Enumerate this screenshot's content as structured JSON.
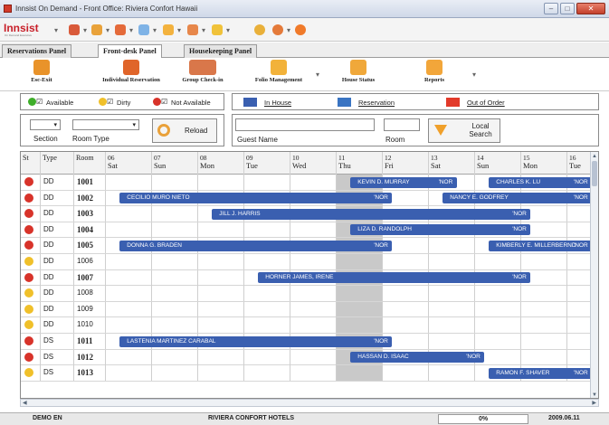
{
  "window": {
    "title": "Innsist On Demand - Front Office: Riviera Confort Hawaii"
  },
  "toolbar": {
    "logo": "Innsist",
    "logo_sub": "On Demand Executive"
  },
  "tabs": [
    "Reservations Panel",
    "Front-desk Panel",
    "Housekeeping Panel"
  ],
  "active_tab": 1,
  "actions": [
    {
      "label": "Esc-Exit",
      "icon": "exit-icon"
    },
    {
      "label": "Individual Reservation",
      "icon": "person-icon"
    },
    {
      "label": "Group Check-in",
      "icon": "group-icon"
    },
    {
      "label": "Folio Management",
      "icon": "folio-icon"
    },
    {
      "label": "House Status",
      "icon": "house-status-icon"
    },
    {
      "label": "Reports",
      "icon": "reports-icon"
    }
  ],
  "legend_status": {
    "available": "Available",
    "dirty": "Dirty",
    "not_available": "Not Available"
  },
  "legend_types": {
    "in_house": "In House",
    "reservation": "Reservation",
    "out_of_order": "Out of Order"
  },
  "filters": {
    "section_label": "Section",
    "room_type_label": "Room Type",
    "reload": "Reload",
    "guest_name_label": "Guest Name",
    "room_label": "Room",
    "local_search": "Local Search"
  },
  "grid": {
    "col_headers": {
      "st": "St",
      "type": "Type",
      "room": "Room"
    },
    "days": [
      {
        "num": "06",
        "day": "Sat"
      },
      {
        "num": "07",
        "day": "Sun"
      },
      {
        "num": "08",
        "day": "Mon"
      },
      {
        "num": "09",
        "day": "Tue"
      },
      {
        "num": "10",
        "day": "Wed"
      },
      {
        "num": "11",
        "day": "Thu"
      },
      {
        "num": "12",
        "day": "Fri"
      },
      {
        "num": "13",
        "day": "Sat"
      },
      {
        "num": "14",
        "day": "Sun"
      },
      {
        "num": "15",
        "day": "Mon"
      },
      {
        "num": "16",
        "day": "Tue"
      }
    ],
    "rows": [
      {
        "status": "red",
        "type": "DD",
        "room": "1001",
        "bold": true
      },
      {
        "status": "red",
        "type": "DD",
        "room": "1002",
        "bold": true
      },
      {
        "status": "red",
        "type": "DD",
        "room": "1003",
        "bold": true
      },
      {
        "status": "red",
        "type": "DD",
        "room": "1004",
        "bold": true
      },
      {
        "status": "red",
        "type": "DD",
        "room": "1005",
        "bold": true
      },
      {
        "status": "yellow",
        "type": "DD",
        "room": "1006",
        "bold": false
      },
      {
        "status": "red",
        "type": "DD",
        "room": "1007",
        "bold": true
      },
      {
        "status": "yellow",
        "type": "DD",
        "room": "1008",
        "bold": false
      },
      {
        "status": "yellow",
        "type": "DD",
        "room": "1009",
        "bold": false
      },
      {
        "status": "yellow",
        "type": "DD",
        "room": "1010",
        "bold": false
      },
      {
        "status": "red",
        "type": "DS",
        "room": "1011",
        "bold": true
      },
      {
        "status": "red",
        "type": "DS",
        "room": "1012",
        "bold": true
      },
      {
        "status": "yellow",
        "type": "DS",
        "room": "1013",
        "bold": true
      }
    ],
    "bookings": [
      {
        "row": 0,
        "start": 5.3,
        "end": 7.6,
        "name": "KEVIN D. MURRAY",
        "code": "NOR"
      },
      {
        "row": 0,
        "start": 8.3,
        "end": 10.7,
        "name": "CHARLES K. LU",
        "code": "NOR"
      },
      {
        "row": 1,
        "start": 0.3,
        "end": 6.2,
        "name": "CECILIO MURO NIETO",
        "code": "NOR"
      },
      {
        "row": 1,
        "start": 7.3,
        "end": 10.7,
        "name": "NANCY E. GODFREY",
        "code": "NOR"
      },
      {
        "row": 2,
        "start": 2.3,
        "end": 9.2,
        "name": "JILL J. HARRIS",
        "code": "NOR"
      },
      {
        "row": 3,
        "start": 5.3,
        "end": 9.2,
        "name": "LIZA D. RANDOLPH",
        "code": "NOR"
      },
      {
        "row": 4,
        "start": 0.3,
        "end": 6.2,
        "name": "DONNA G. BRADEN",
        "code": "NOR"
      },
      {
        "row": 4,
        "start": 8.3,
        "end": 10.7,
        "name": "KIMBERLY E. MILLERBERND",
        "code": "NOR"
      },
      {
        "row": 6,
        "start": 3.3,
        "end": 9.2,
        "name": "HORNER JAMES, IRENE",
        "code": "NOR"
      },
      {
        "row": 10,
        "start": 0.3,
        "end": 6.2,
        "name": "LASTENIA MARTINEZ CARABAL",
        "code": "NOR"
      },
      {
        "row": 11,
        "start": 5.3,
        "end": 8.2,
        "name": "HASSAN D. ISAAC",
        "code": "NOR"
      },
      {
        "row": 12,
        "start": 8.3,
        "end": 10.7,
        "name": "RAMON F. SHAVER",
        "code": "NOR"
      }
    ]
  },
  "colors": {
    "in_house": "#3a5fb0",
    "reservation": "#3a74c2",
    "out_of_order": "#e23a2a",
    "available": "#3fae2a",
    "dirty": "#f0c02a",
    "not_available": "#d8332a"
  },
  "statusbar": {
    "user": "DEMO EN",
    "hotel": "RIVIERA CONFORT HOTELS",
    "progress": "0%",
    "date": "2009.06.11"
  }
}
